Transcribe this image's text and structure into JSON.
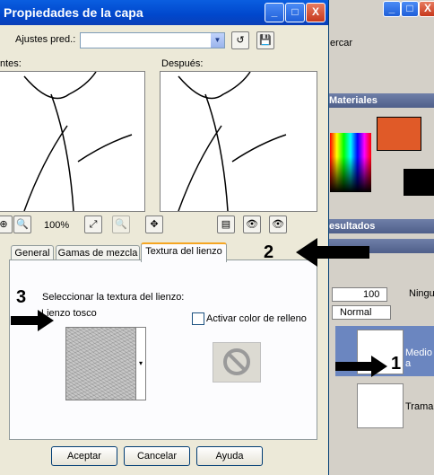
{
  "dialog": {
    "title": "Propiedades de la capa",
    "controls": [
      "_",
      "□",
      "X"
    ],
    "presets_label": "Ajustes pred.:",
    "presets_value": "",
    "before_label": "ntes:",
    "after_label": "Después:",
    "zoom": "100%",
    "tabs": [
      "General",
      "Gamas de mezcla",
      "Textura del lienzo"
    ],
    "texture_prompt": "Seleccionar la textura del lienzo:",
    "texture_name": "Lienzo tosco",
    "fill_checkbox_label": "Activar color de relleno",
    "fill_checked": false,
    "buttons": {
      "ok": "Aceptar",
      "cancel": "Cancelar",
      "help": "Ayuda"
    }
  },
  "annotations": {
    "a1": "1",
    "a2": "2",
    "a3": "3"
  },
  "right": {
    "top_text": "ercar",
    "materials_title": "Materiales",
    "results_title": "esultados",
    "opacity": "100",
    "blend_mode": "Normal",
    "lock_label": "Ninguno",
    "layer1": "Medio a",
    "layer2": "Trama",
    "accent_color": "#e05a28"
  }
}
